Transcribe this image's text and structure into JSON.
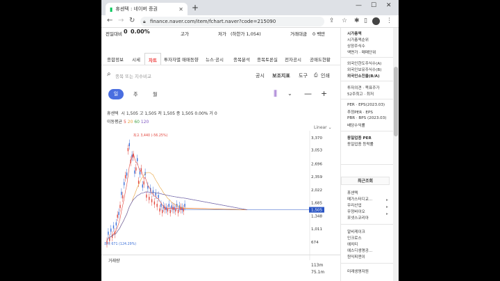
{
  "browser": {
    "tab_title": "휴센텍 : 네이버 증권",
    "url": "finance.naver.com/item/fchart.naver?code=215090"
  },
  "summary": {
    "change_label": "전일대비",
    "change_value": "0",
    "change_pct": "0.00%",
    "high_label": "고가",
    "low_label": "저가",
    "low_value": "(하한가 1,054)",
    "amount_label": "거래대금",
    "amount_value": "0 백만"
  },
  "nav_tabs": [
    "종합정보",
    "시세",
    "차트",
    "투자자별 매매동향",
    "뉴스·공시",
    "종목분석",
    "종목토론실",
    "전자공시",
    "공매도현황"
  ],
  "active_tab": "차트",
  "search": {
    "placeholder": "종목 또는 지수비교",
    "links": [
      "공시",
      "보조지표",
      "도구",
      "인쇄"
    ]
  },
  "period": {
    "active": "일",
    "options": [
      "주",
      "월"
    ]
  },
  "price_info": {
    "name": "휴센텍",
    "text": "시 1,505  고 1,505  저 1,505  종 1,505  0.00%  거 0"
  },
  "ma_info": {
    "label": "이동평균",
    "ma5": "5",
    "ma20": "20",
    "ma60": "60",
    "ma120": "120"
  },
  "scale_label": "Linear",
  "chart_data": {
    "type": "line",
    "y_ticks": [
      3370,
      3053,
      2696,
      2359,
      2022,
      1685,
      1348,
      1011,
      674
    ],
    "current_price": "1,505",
    "high_marker": "최고 3,440 (-56.25%)",
    "low_marker": "최저 671 (124.29%)",
    "colors": {
      "ma5": "#e2443b",
      "ma20": "#e8a23a",
      "ma60": "#43a047",
      "ma120": "#7e57c2",
      "price": "#2a55c4",
      "up": "#e2443b",
      "down": "#3a6fd8"
    }
  },
  "volume": {
    "label": "거래량",
    "ticks": [
      "113m",
      "75.1m"
    ]
  },
  "right_panel": {
    "market_cap_title": "시가총액",
    "lines_top": [
      "시가총액순위",
      "상장주식수",
      "액면가 · 매매단위"
    ],
    "lines_foreign": [
      "외국인한도주식수(A)",
      "외국인보유주식수(B)",
      "외국인소진율(B/A)"
    ],
    "lines_invest": [
      "투자의견 · 목표주가",
      "52주최고 · 최저"
    ],
    "lines_per": [
      "PER · EPS(2023.03)",
      "추정PER · EPS",
      "PBR · BPS (2023.03)",
      "배당수익률"
    ],
    "lines_industry": [
      "동일업종 PER",
      "동일업종 등락률"
    ],
    "recent_title": "최근조회",
    "recent_items": [
      "휴센텍",
      "메가스터디교...",
      "우리산업",
      "우정바이오",
      "포넷스코리아"
    ],
    "popular_items": [
      "알비케이크",
      "인크로스",
      "에치티",
      "에스디생명공...",
      "원익피앤이"
    ],
    "bottom_item": "미래생명자원"
  }
}
